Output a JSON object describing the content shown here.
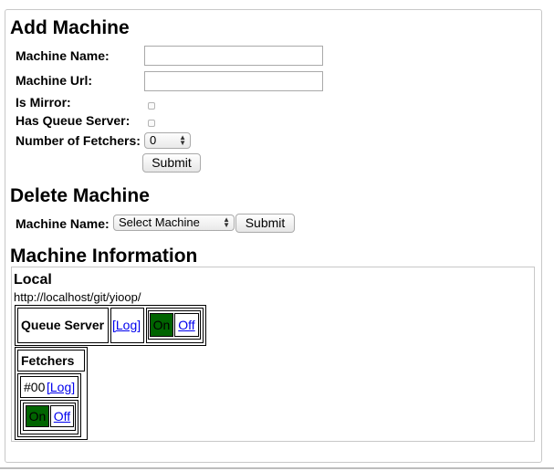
{
  "add_machine": {
    "title": "Add Machine",
    "machine_name_label": "Machine Name:",
    "machine_name_value": "",
    "machine_url_label": "Machine Url:",
    "machine_url_value": "",
    "is_mirror_label": "Is Mirror:",
    "is_mirror_checked": false,
    "has_queue_server_label": "Has Queue Server:",
    "has_queue_server_checked": false,
    "num_fetchers_label": "Number of Fetchers:",
    "num_fetchers_value": "0",
    "submit_label": "Submit"
  },
  "delete_machine": {
    "title": "Delete Machine",
    "machine_name_label": "Machine Name:",
    "select_value": "Select Machine",
    "submit_label": "Submit"
  },
  "machine_information": {
    "title": "Machine Information",
    "machine": {
      "name": "Local",
      "url": "http://localhost/git/yioop/",
      "queue_server": {
        "label": "Queue Server",
        "log_link": "[Log]",
        "on_label": "On",
        "off_label": "Off"
      },
      "fetchers": {
        "label": "Fetchers",
        "items": [
          {
            "id": "#00",
            "log_link": "[Log]",
            "on_label": "On",
            "off_label": "Off"
          }
        ]
      }
    }
  },
  "colors": {
    "on_green": "#006400",
    "link_blue": "#0000ee"
  }
}
